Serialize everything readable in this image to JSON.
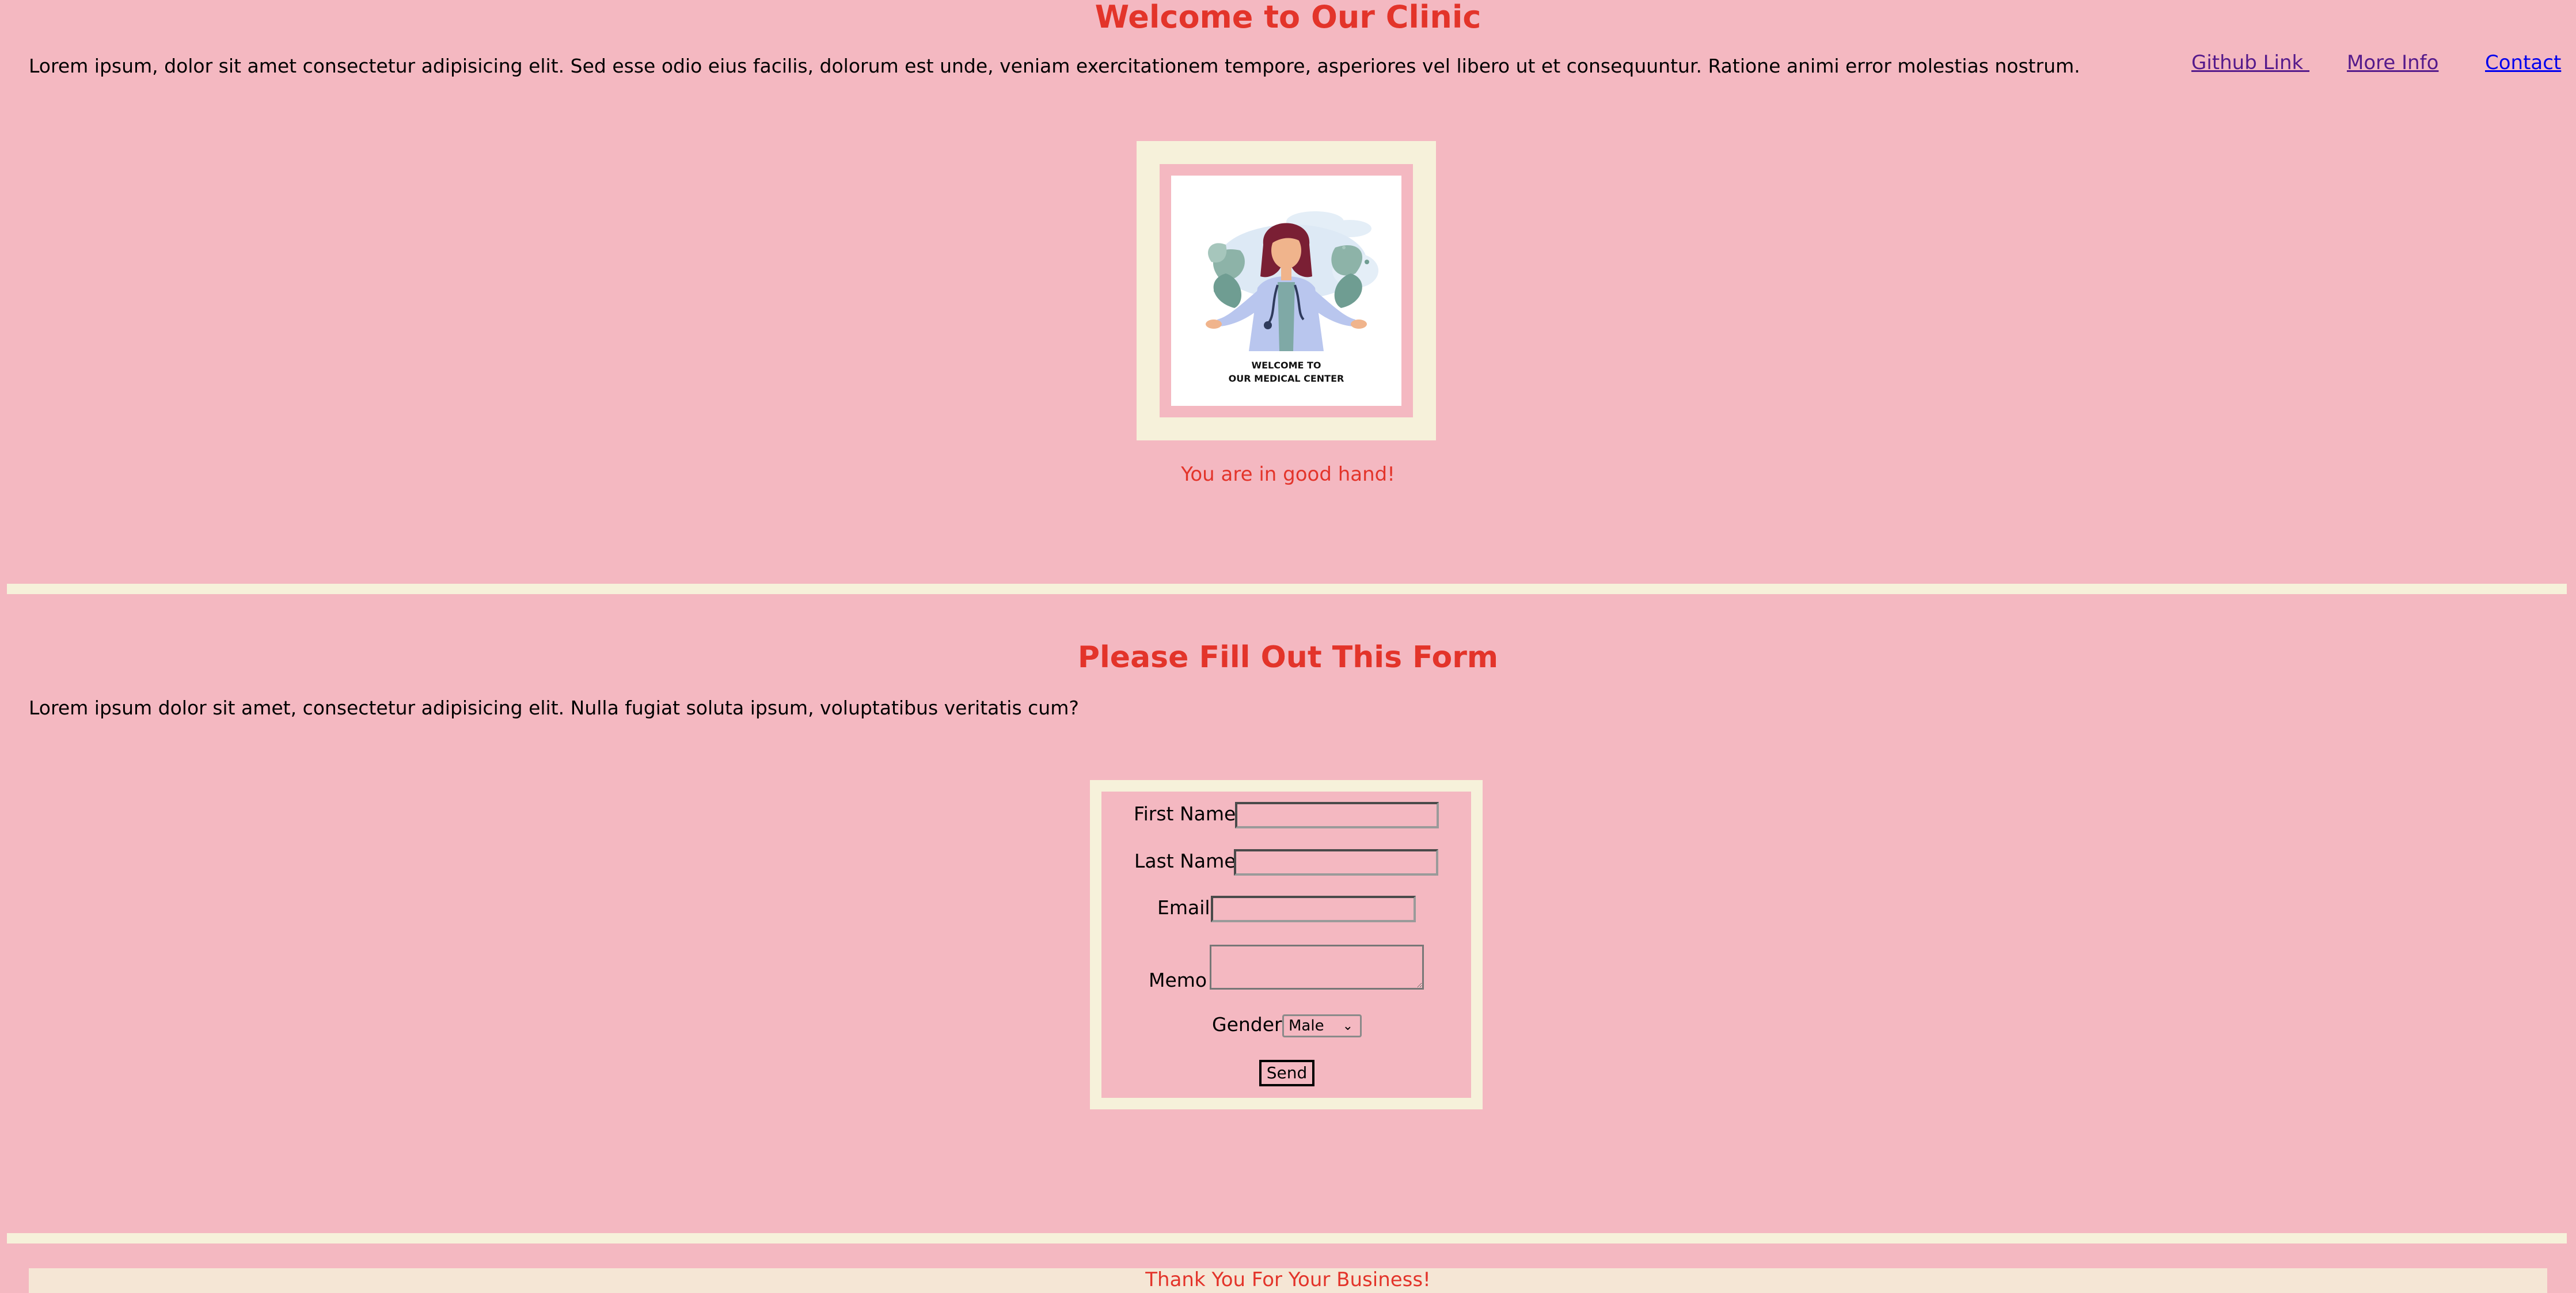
{
  "header": {
    "title": "Welcome to Our Clinic",
    "intro": "Lorem ipsum, dolor sit amet consectetur adipisicing elit. Sed esse odio eius facilis, dolorum est unde, veniam exercitationem tempore, asperiores vel libero ut et consequuntur. Ratione animi error molestias nostrum."
  },
  "nav": {
    "github": "Github Link ",
    "more_info": "More Info",
    "contact": "Contact"
  },
  "hero": {
    "image_text_line1": "WELCOME TO",
    "image_text_line2": "OUR  MEDICAL CENTER",
    "caption": "You are in good hand!"
  },
  "form": {
    "title": "Please Fill Out This Form",
    "intro": "Lorem ipsum dolor sit amet, consectetur adipisicing elit. Nulla fugiat soluta ipsum, voluptatibus veritatis cum?",
    "first_name_label": "First Name",
    "first_name_value": "",
    "last_name_label": "Last Name",
    "last_name_value": "",
    "email_label": "Email",
    "email_value": "",
    "memo_label": "Memo",
    "memo_value": "",
    "gender_label": "Gender",
    "gender_selected": "Male",
    "send_label": "Send"
  },
  "footer": {
    "text": "Thank You For Your Business!"
  },
  "colors": {
    "background": "#f4b8c1",
    "accent_red": "#e3342a",
    "cream": "#f6f1da"
  }
}
